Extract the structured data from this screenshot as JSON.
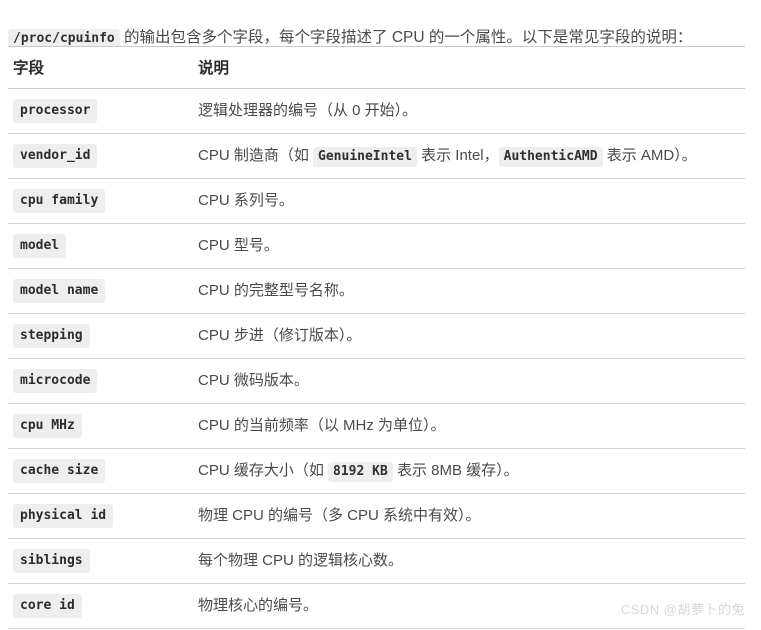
{
  "intro": {
    "code": "/proc/cpuinfo",
    "text": " 的输出包含多个字段，每个字段描述了 CPU 的一个属性。以下是常见字段的说明："
  },
  "table": {
    "headers": {
      "field": "字段",
      "description": "说明"
    },
    "rows": [
      {
        "field": "processor",
        "desc_pre": "逻辑处理器的编号（从 0 开始）。",
        "codes": []
      },
      {
        "field": "vendor_id",
        "desc_pre": "CPU 制造商（如 ",
        "code1": "GenuineIntel",
        "desc_mid": " 表示 Intel，",
        "code2": "AuthenticAMD",
        "desc_post": " 表示 AMD）。"
      },
      {
        "field": "cpu family",
        "desc_pre": "CPU 系列号。",
        "codes": []
      },
      {
        "field": "model",
        "desc_pre": "CPU 型号。",
        "codes": []
      },
      {
        "field": "model name",
        "desc_pre": "CPU 的完整型号名称。",
        "codes": []
      },
      {
        "field": "stepping",
        "desc_pre": "CPU 步进（修订版本）。",
        "codes": []
      },
      {
        "field": "microcode",
        "desc_pre": "CPU 微码版本。",
        "codes": []
      },
      {
        "field": "cpu MHz",
        "desc_pre": "CPU 的当前频率（以 MHz 为单位）。",
        "codes": []
      },
      {
        "field": "cache size",
        "desc_pre": "CPU 缓存大小（如 ",
        "code1": "8192 KB",
        "desc_mid": " 表示 8MB 缓存）。",
        "desc_post": ""
      },
      {
        "field": "physical id",
        "desc_pre": "物理 CPU 的编号（多 CPU 系统中有效）。",
        "codes": []
      },
      {
        "field": "siblings",
        "desc_pre": "每个物理 CPU 的逻辑核心数。",
        "codes": []
      },
      {
        "field": "core id",
        "desc_pre": "物理核心的编号。",
        "codes": []
      }
    ]
  },
  "watermark": "CSDN @胡萝卜的兔",
  "colors": {
    "code_background": "#eeeeee",
    "text": "#4a4a4a",
    "divider": "#d4d4d4",
    "watermark": "#d6d6d6"
  }
}
